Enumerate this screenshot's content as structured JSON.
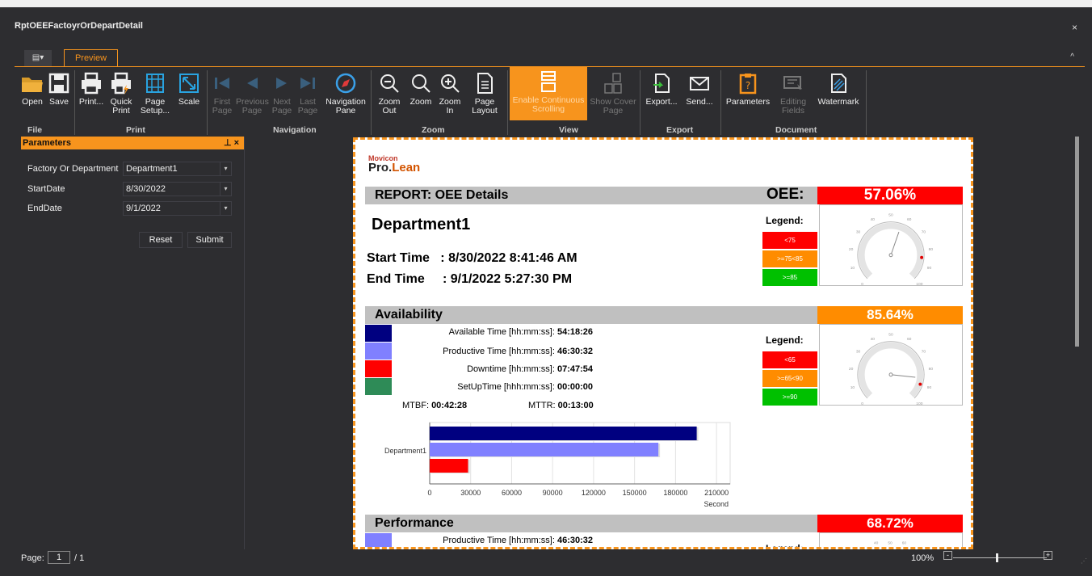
{
  "window": {
    "title": "RptOEEFactoyrOrDepartDetail",
    "close": "×"
  },
  "tabs": {
    "menu_icon": "▤▾",
    "preview": "Preview",
    "collapse": "^"
  },
  "ribbon": {
    "buttons": {
      "open": "Open",
      "save": "Save",
      "print": "Print...",
      "quick_print": "Quick Print",
      "page_setup": "Page Setup...",
      "scale": "Scale",
      "first_page": "First Page",
      "previous_page": "Previous Page",
      "next_page": "Next Page",
      "last_page": "Last Page",
      "navigation_pane": "Navigation Pane",
      "zoom_out": "Zoom Out",
      "zoom": "Zoom",
      "zoom_in": "Zoom In",
      "page_layout": "Page Layout",
      "continuous": "Enable Continuous Scrolling",
      "show_cover": "Show Cover Page",
      "export": "Export...",
      "send": "Send...",
      "parameters": "Parameters",
      "editing_fields": "Editing Fields",
      "watermark": "Watermark"
    },
    "groups": {
      "file": "File",
      "print": "Print",
      "navigation": "Navigation",
      "zoom": "Zoom",
      "view": "View",
      "export": "Export",
      "document": "Document"
    }
  },
  "parameters": {
    "header": "Parameters",
    "factory_label": "Factory Or Department",
    "factory_value": "Department1",
    "start_label": "StartDate",
    "start_value": "8/30/2022",
    "end_label": "EndDate",
    "end_value": "9/1/2022",
    "reset": "Reset",
    "submit": "Submit"
  },
  "report": {
    "logo_top": "Movicon",
    "logo_pro": "Pro.",
    "logo_lean": "Lean",
    "title": "REPORT: OEE  Details",
    "oee_label": "OEE:",
    "oee_value": "57.06%",
    "department": "Department1",
    "start_time": "Start Time   : 8/30/2022 8:41:46 AM",
    "end_time": "End Time     : 9/1/2022 5:27:30 PM",
    "legend": "Legend:",
    "oee_legend": [
      "<75",
      ">=75<85",
      ">=85"
    ],
    "availability": {
      "title": "Availability",
      "value": "85.64%",
      "available_label": "Available Time [hh:mm:ss]: ",
      "available": "54:18:26",
      "productive_label": "Productive Time [hh:mm:ss]: ",
      "productive": "46:30:32",
      "downtime_label": "Downtime [hh:mm:ss]: ",
      "downtime": "07:47:54",
      "setup_label": "SetUpTime [hhh:mm:ss]: ",
      "setup": "00:00:00",
      "mtbf_label": "MTBF: ",
      "mtbf": "00:42:28",
      "mttr_label": "MTTR: ",
      "mttr": "00:13:00",
      "legend": [
        "<65",
        ">=65<90",
        ">=90"
      ]
    },
    "performance": {
      "title": "Performance",
      "value": "68.72%",
      "productive_label": "Productive Time [hh:mm:ss]: ",
      "productive": "46:30:32"
    }
  },
  "colors": {
    "accent": "#f7941d",
    "red": "#ff0000",
    "orange": "#ff8c00",
    "green": "#00c000",
    "navy": "#000080",
    "lavender": "#8080ff",
    "seagreen": "#2e8b57"
  },
  "chart_data": {
    "type": "bar",
    "categories": [
      "Department1"
    ],
    "series": [
      {
        "values": [
          195506
        ]
      },
      {
        "values": [
          167432
        ]
      },
      {
        "values": [
          28074
        ]
      }
    ],
    "xlabel": "Second",
    "xlim": [
      0,
      220000
    ],
    "xticks": [
      "0",
      "30000",
      "60000",
      "90000",
      "120000",
      "150000",
      "180000",
      "210000"
    ],
    "orientation": "horizontal"
  },
  "gauges": {
    "ticks": [
      "0",
      "10",
      "20",
      "30",
      "40",
      "50",
      "60",
      "70",
      "80",
      "90",
      "100"
    ]
  },
  "statusbar": {
    "page_label": "Page:",
    "page": "1",
    "total": "/ 1",
    "zoom": "100%",
    "minus": "-",
    "plus": "+"
  }
}
